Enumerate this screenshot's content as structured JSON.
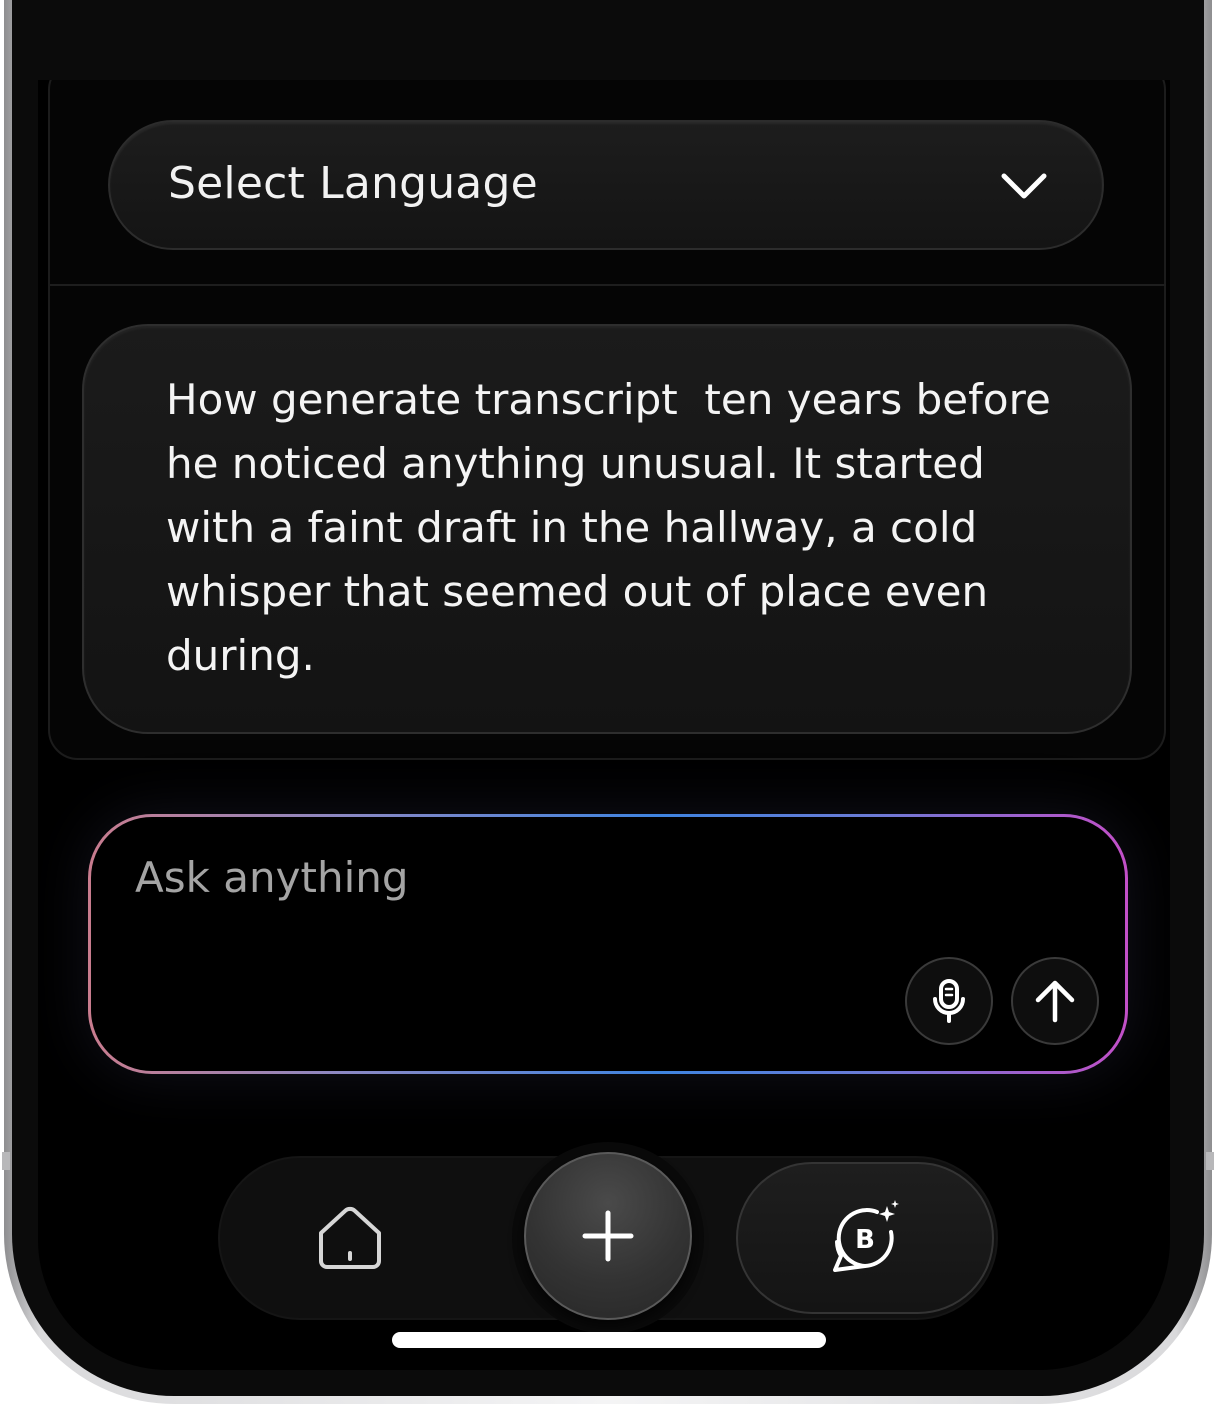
{
  "language_select": {
    "label": "Select Language",
    "chevron_icon": "chevron-down-icon"
  },
  "transcript": {
    "text": "How generate transcript  ten years before he noticed anything unusual. It started with a faint draft in the hallway, a cold whisper that seemed out of place even during."
  },
  "ask": {
    "placeholder": "Ask anything",
    "mic_icon": "microphone-icon",
    "send_icon": "arrow-up-icon",
    "border_colors": [
      "#c97c8e",
      "#3f84e0",
      "#c24fc7"
    ]
  },
  "nav": {
    "home_icon": "home-icon",
    "add_icon": "plus-icon",
    "ai_chat_icon": "ai-chat-bubble-icon",
    "ai_chat_letter": "B"
  }
}
